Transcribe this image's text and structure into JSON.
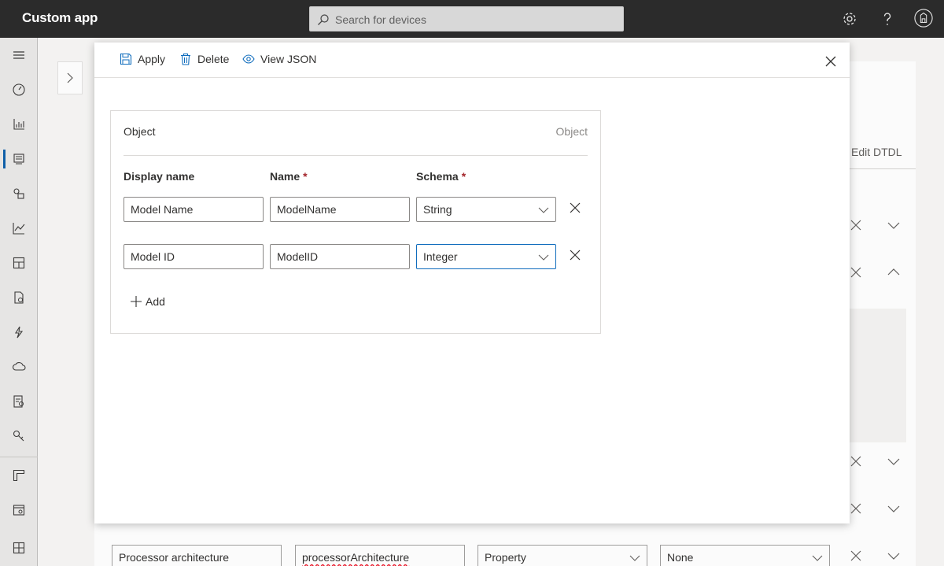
{
  "app": {
    "title": "Custom app"
  },
  "search": {
    "placeholder": "Search for devices"
  },
  "topbar_icons": [
    "settings-icon",
    "help-icon",
    "account-icon"
  ],
  "background": {
    "edit_dtdl_label": "Edit DTDL",
    "bottom_row": {
      "display_name": "Processor architecture",
      "name": "processorArchitecture",
      "capability_type": "Property",
      "semantic_type": "None"
    }
  },
  "toolbar": {
    "apply_label": "Apply",
    "delete_label": "Delete",
    "view_json_label": "View JSON"
  },
  "object": {
    "label": "Object",
    "type": "Object",
    "headers": {
      "display_name": "Display name",
      "name": "Name",
      "schema": "Schema",
      "required_mark": "*"
    },
    "rows": [
      {
        "display_name": "Model Name",
        "name": "ModelName",
        "schema": "String"
      },
      {
        "display_name": "Model ID",
        "name": "ModelID",
        "schema": "Integer"
      }
    ],
    "add_label": "Add"
  },
  "colors": {
    "topbar": "#2b2b2b",
    "accent": "#0f6cbd",
    "required": "#a4262c"
  }
}
